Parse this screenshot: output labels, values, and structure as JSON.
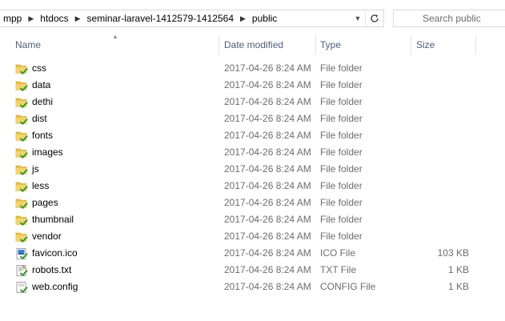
{
  "breadcrumb": [
    {
      "label": "mpp"
    },
    {
      "label": "htdocs"
    },
    {
      "label": "seminar-laravel-1412579-1412564"
    },
    {
      "label": "public"
    }
  ],
  "search": {
    "placeholder": "Search public"
  },
  "columns": {
    "name": "Name",
    "date": "Date modified",
    "type": "Type",
    "size": "Size"
  },
  "files": [
    {
      "name": "css",
      "date": "2017-04-26 8:24 AM",
      "type": "File folder",
      "size": "",
      "icon": "folder-icon"
    },
    {
      "name": "data",
      "date": "2017-04-26 8:24 AM",
      "type": "File folder",
      "size": "",
      "icon": "folder-icon"
    },
    {
      "name": "dethi",
      "date": "2017-04-26 8:24 AM",
      "type": "File folder",
      "size": "",
      "icon": "folder-icon"
    },
    {
      "name": "dist",
      "date": "2017-04-26 8:24 AM",
      "type": "File folder",
      "size": "",
      "icon": "folder-icon"
    },
    {
      "name": "fonts",
      "date": "2017-04-26 8:24 AM",
      "type": "File folder",
      "size": "",
      "icon": "folder-icon"
    },
    {
      "name": "images",
      "date": "2017-04-26 8:24 AM",
      "type": "File folder",
      "size": "",
      "icon": "folder-icon"
    },
    {
      "name": "js",
      "date": "2017-04-26 8:24 AM",
      "type": "File folder",
      "size": "",
      "icon": "folder-icon"
    },
    {
      "name": "less",
      "date": "2017-04-26 8:24 AM",
      "type": "File folder",
      "size": "",
      "icon": "folder-icon"
    },
    {
      "name": "pages",
      "date": "2017-04-26 8:24 AM",
      "type": "File folder",
      "size": "",
      "icon": "folder-icon"
    },
    {
      "name": "thumbnail",
      "date": "2017-04-26 8:24 AM",
      "type": "File folder",
      "size": "",
      "icon": "folder-icon"
    },
    {
      "name": "vendor",
      "date": "2017-04-26 8:24 AM",
      "type": "File folder",
      "size": "",
      "icon": "folder-icon"
    },
    {
      "name": "favicon.ico",
      "date": "2017-04-26 8:24 AM",
      "type": "ICO File",
      "size": "103 KB",
      "icon": "image-file-icon"
    },
    {
      "name": "robots.txt",
      "date": "2017-04-26 8:24 AM",
      "type": "TXT File",
      "size": "1 KB",
      "icon": "text-file-icon"
    },
    {
      "name": "web.config",
      "date": "2017-04-26 8:24 AM",
      "type": "CONFIG File",
      "size": "1 KB",
      "icon": "config-file-icon"
    }
  ],
  "colors": {
    "folder": "#e8c13f",
    "check": "#2d9a2d",
    "header_text": "#4c607a",
    "detail_text": "#6d6d6d"
  }
}
